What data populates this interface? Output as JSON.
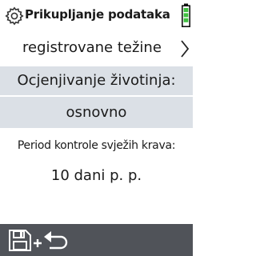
{
  "header": {
    "title": "Prikupljanje podataka",
    "settings_icon": "gear-icon",
    "battery_icon": "battery-icon",
    "battery_color": "#3fbf3f"
  },
  "menu": {
    "link_label": "registrovane težine",
    "link_icon": "chevron-right-icon",
    "section_title": "Ocjenjivanje životinja:",
    "section_value": "osnovno",
    "section_bg": "#dbe0e6"
  },
  "field": {
    "label": "Period kontrole svježih krava:",
    "value": "10 dani p. p."
  },
  "footer": {
    "action_icon": "save-and-return-icon",
    "bg": "#505359"
  }
}
